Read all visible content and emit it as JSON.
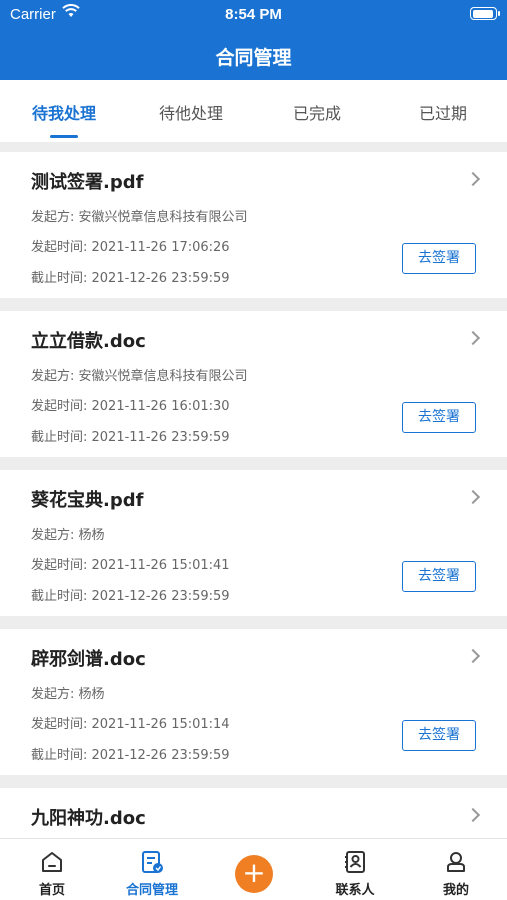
{
  "status": {
    "carrier": "Carrier",
    "time": "8:54 PM"
  },
  "header": {
    "title": "合同管理"
  },
  "tabs": [
    {
      "label": "待我处理",
      "active": true
    },
    {
      "label": "待他处理",
      "active": false
    },
    {
      "label": "已完成",
      "active": false
    },
    {
      "label": "已过期",
      "active": false
    }
  ],
  "contracts": [
    {
      "title": "测试签署.pdf",
      "initiator": "发起方: 安徽兴悦章信息科技有限公司",
      "start": "发起时间: 2021-11-26 17:06:26",
      "deadline": "截止时间: 2021-12-26 23:59:59",
      "action": "去签署"
    },
    {
      "title": "立立借款.doc",
      "initiator": "发起方: 安徽兴悦章信息科技有限公司",
      "start": "发起时间: 2021-11-26 16:01:30",
      "deadline": "截止时间: 2021-11-26 23:59:59",
      "action": "去签署"
    },
    {
      "title": "葵花宝典.pdf",
      "initiator": "发起方: 杨杨",
      "start": "发起时间: 2021-11-26 15:01:41",
      "deadline": "截止时间: 2021-12-26 23:59:59",
      "action": "去签署"
    },
    {
      "title": "辟邪剑谱.doc",
      "initiator": "发起方: 杨杨",
      "start": "发起时间: 2021-11-26 15:01:14",
      "deadline": "截止时间: 2021-12-26 23:59:59",
      "action": "去签署"
    },
    {
      "title": "九阳神功.doc"
    }
  ],
  "tabbar": {
    "home": "首页",
    "contracts": "合同管理",
    "add": "+",
    "contacts": "联系人",
    "mine": "我的"
  },
  "colors": {
    "primary": "#1a73d2",
    "accent": "#f07f24"
  }
}
